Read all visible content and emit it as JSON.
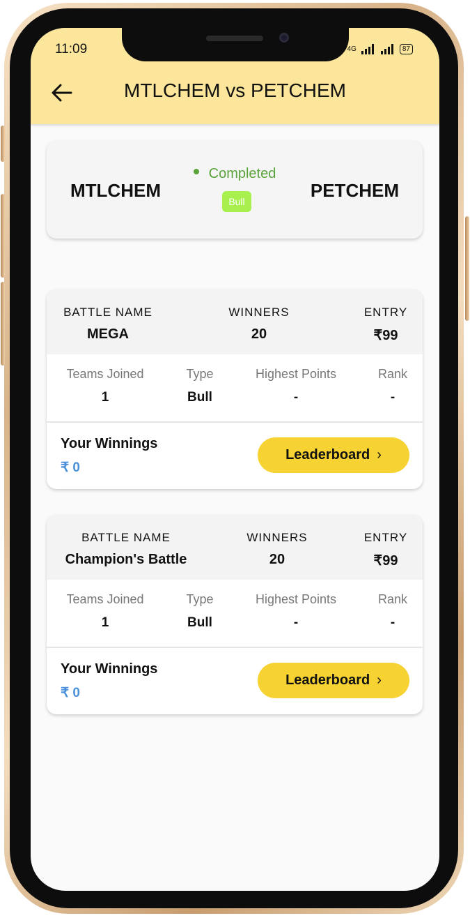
{
  "status_bar": {
    "time": "11:09",
    "network": "4G",
    "battery": "87"
  },
  "header": {
    "title": "MTLCHEM vs PETCHEM"
  },
  "match": {
    "team_left": "MTLCHEM",
    "team_right": "PETCHEM",
    "status": "Completed",
    "badge": "Bull",
    "colors": {
      "status": "#5aa33a",
      "badge": "#a7f04e",
      "accent": "#f6d233",
      "header_bg": "#fbe69b"
    }
  },
  "battles": [
    {
      "battle_name_label": "BATTLE NAME",
      "battle_name": "MEGA",
      "winners_label": "WINNERS",
      "winners": "20",
      "entry_label": "ENTRY",
      "entry": "₹99",
      "teams_joined_label": "Teams Joined",
      "teams_joined": "1",
      "type_label": "Type",
      "type": "Bull",
      "highest_points_label": "Highest Points",
      "highest_points": "-",
      "rank_label": "Rank",
      "rank": "-",
      "winnings_label": "Your Winnings",
      "winnings": "₹ 0",
      "leaderboard_label": "Leaderboard"
    },
    {
      "battle_name_label": "BATTLE NAME",
      "battle_name": "Champion's Battle",
      "winners_label": "WINNERS",
      "winners": "20",
      "entry_label": "ENTRY",
      "entry": "₹99",
      "teams_joined_label": "Teams Joined",
      "teams_joined": "1",
      "type_label": "Type",
      "type": "Bull",
      "highest_points_label": "Highest Points",
      "highest_points": "-",
      "rank_label": "Rank",
      "rank": "-",
      "winnings_label": "Your Winnings",
      "winnings": "₹ 0",
      "leaderboard_label": "Leaderboard"
    }
  ]
}
